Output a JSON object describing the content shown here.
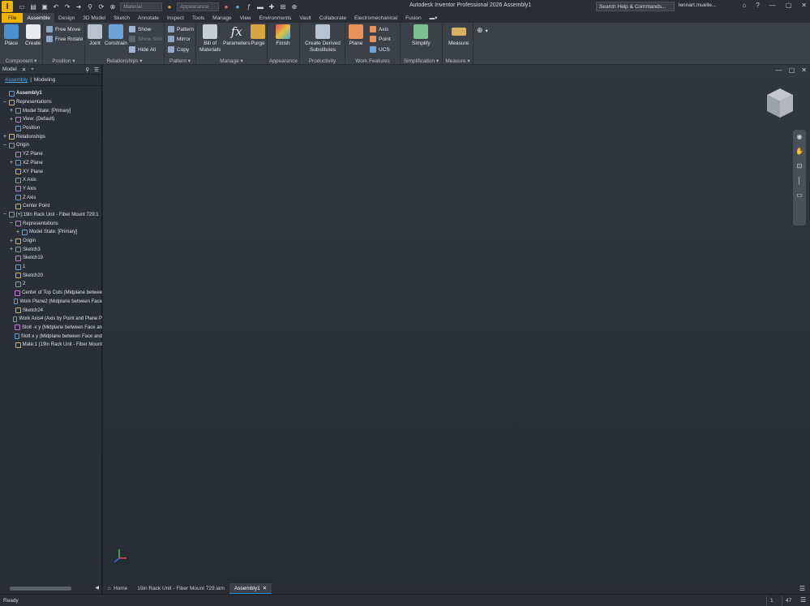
{
  "app": {
    "logo": "I",
    "title": "Autodesk Inventor Professional 2026    Assembly1",
    "search_placeholder": "Search Help & Commands...",
    "user": "lennart.muelle...",
    "material_placeholder": "Material",
    "appearance_placeholder": "Appearance"
  },
  "tabs": [
    "File",
    "Assemble",
    "Design",
    "3D Model",
    "Sketch",
    "Annotate",
    "Inspect",
    "Tools",
    "Manage",
    "View",
    "Environments",
    "Vault",
    "Collaborate",
    "Electromechanical",
    "Fusion"
  ],
  "ribbon": {
    "place": "Place",
    "create": "Create",
    "free_move": "Free Move",
    "free_rotate": "Free Rotate",
    "joint": "Joint",
    "constrain": "Constrain",
    "show": "Show",
    "show_sick": "Show Sick",
    "hide_all": "Hide All",
    "pattern": "Pattern",
    "mirror": "Mirror",
    "copy": "Copy",
    "bom1": "Bill of",
    "bom2": "Materials",
    "parameters": "Parameters",
    "purge": "Purge",
    "finish": "Finish",
    "cds1": "Create Derived",
    "cds2": "Substitutes",
    "plane": "Plane",
    "axis": "Axis",
    "point": "Point",
    "ucs": "UCS",
    "simplify": "Simplify",
    "measure": "Measure",
    "panels": [
      "Component ▾",
      "Position ▾",
      "Relationships ▾",
      "Pattern ▾",
      "Manage ▾",
      "Appearance",
      "Productivity",
      "Work Features",
      "Simplification ▾",
      "Measure ▾"
    ]
  },
  "browser": {
    "title": "Model",
    "sub_assembly": "Assembly",
    "sub_modeling": "Modeling",
    "tree": [
      {
        "t": "Assembly1",
        "lvl": 0,
        "tog": "",
        "bold": true
      },
      {
        "t": "Representations",
        "lvl": 0,
        "tog": "−"
      },
      {
        "t": "Model State: [Primary]",
        "lvl": 1,
        "tog": "+"
      },
      {
        "t": "View: (Default)",
        "lvl": 1,
        "tog": "+"
      },
      {
        "t": "Position",
        "lvl": 1,
        "tog": ""
      },
      {
        "t": "Relationships",
        "lvl": 0,
        "tog": "+"
      },
      {
        "t": "Origin",
        "lvl": 0,
        "tog": "−"
      },
      {
        "t": "YZ Plane",
        "lvl": 1,
        "tog": ""
      },
      {
        "t": "XZ Plane",
        "lvl": 1,
        "tog": "+"
      },
      {
        "t": "XY Plane",
        "lvl": 1,
        "tog": ""
      },
      {
        "t": "X Axis",
        "lvl": 1,
        "tog": ""
      },
      {
        "t": "Y Axis",
        "lvl": 1,
        "tog": ""
      },
      {
        "t": "Z Axis",
        "lvl": 1,
        "tog": ""
      },
      {
        "t": "Center Point",
        "lvl": 1,
        "tog": ""
      },
      {
        "t": "[+]:19in Rack Unit - Fiber Mount 729:1",
        "lvl": 0,
        "tog": "−"
      },
      {
        "t": "Representations",
        "lvl": 1,
        "tog": "−"
      },
      {
        "t": "Model State: [Primary]",
        "lvl": 2,
        "tog": "+"
      },
      {
        "t": "Origin",
        "lvl": 1,
        "tog": "+"
      },
      {
        "t": "Sketch3",
        "lvl": 1,
        "tog": "+"
      },
      {
        "t": "Sketch19",
        "lvl": 1,
        "tog": ""
      },
      {
        "t": "1",
        "lvl": 1,
        "tog": ""
      },
      {
        "t": "Sketch20",
        "lvl": 1,
        "tog": ""
      },
      {
        "t": "2",
        "lvl": 1,
        "tog": ""
      },
      {
        "t": "Center of Top Cuts (Midplane betwee",
        "lvl": 1,
        "tog": ""
      },
      {
        "t": "Work Plane2 (Midplane between Face",
        "lvl": 1,
        "tog": ""
      },
      {
        "t": "Sketch24",
        "lvl": 1,
        "tog": ""
      },
      {
        "t": "Work Axis4 (Axis by Point and Plane P",
        "lvl": 1,
        "tog": ""
      },
      {
        "t": "Slott -x y (Midplane between Face an",
        "lvl": 1,
        "tog": ""
      },
      {
        "t": "Slott x y (Midplane between Face and",
        "lvl": 1,
        "tog": ""
      },
      {
        "t": "Mate:1 (19in Rack Unit - Fiber Mount",
        "lvl": 1,
        "tog": ""
      }
    ]
  },
  "doctabs": {
    "home": "Home",
    "doc1": "19in Rack Unit - Fiber Mount 729.iam",
    "doc2": "Assembly1"
  },
  "status": {
    "text": "Ready",
    "n1": "1",
    "n2": "47"
  },
  "colors": {
    "accent": "#f0b400",
    "select": "#1b8fe0"
  }
}
